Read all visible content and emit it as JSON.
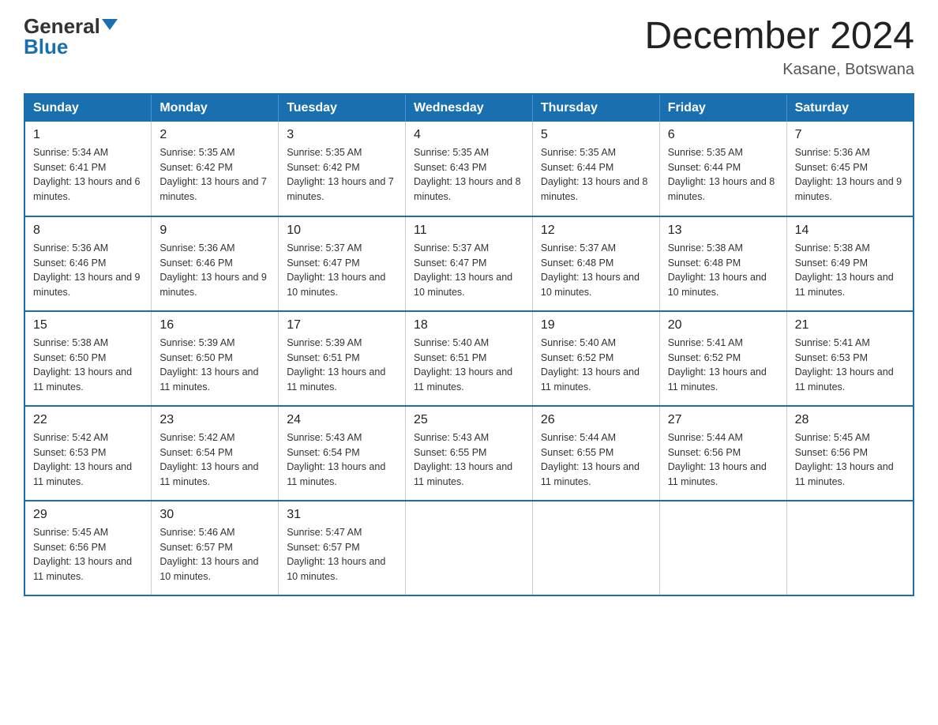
{
  "header": {
    "logo_general": "General",
    "logo_blue": "Blue",
    "month_title": "December 2024",
    "location": "Kasane, Botswana"
  },
  "days_of_week": [
    "Sunday",
    "Monday",
    "Tuesday",
    "Wednesday",
    "Thursday",
    "Friday",
    "Saturday"
  ],
  "weeks": [
    [
      {
        "day": "1",
        "sunrise": "5:34 AM",
        "sunset": "6:41 PM",
        "daylight": "13 hours and 6 minutes."
      },
      {
        "day": "2",
        "sunrise": "5:35 AM",
        "sunset": "6:42 PM",
        "daylight": "13 hours and 7 minutes."
      },
      {
        "day": "3",
        "sunrise": "5:35 AM",
        "sunset": "6:42 PM",
        "daylight": "13 hours and 7 minutes."
      },
      {
        "day": "4",
        "sunrise": "5:35 AM",
        "sunset": "6:43 PM",
        "daylight": "13 hours and 8 minutes."
      },
      {
        "day": "5",
        "sunrise": "5:35 AM",
        "sunset": "6:44 PM",
        "daylight": "13 hours and 8 minutes."
      },
      {
        "day": "6",
        "sunrise": "5:35 AM",
        "sunset": "6:44 PM",
        "daylight": "13 hours and 8 minutes."
      },
      {
        "day": "7",
        "sunrise": "5:36 AM",
        "sunset": "6:45 PM",
        "daylight": "13 hours and 9 minutes."
      }
    ],
    [
      {
        "day": "8",
        "sunrise": "5:36 AM",
        "sunset": "6:46 PM",
        "daylight": "13 hours and 9 minutes."
      },
      {
        "day": "9",
        "sunrise": "5:36 AM",
        "sunset": "6:46 PM",
        "daylight": "13 hours and 9 minutes."
      },
      {
        "day": "10",
        "sunrise": "5:37 AM",
        "sunset": "6:47 PM",
        "daylight": "13 hours and 10 minutes."
      },
      {
        "day": "11",
        "sunrise": "5:37 AM",
        "sunset": "6:47 PM",
        "daylight": "13 hours and 10 minutes."
      },
      {
        "day": "12",
        "sunrise": "5:37 AM",
        "sunset": "6:48 PM",
        "daylight": "13 hours and 10 minutes."
      },
      {
        "day": "13",
        "sunrise": "5:38 AM",
        "sunset": "6:48 PM",
        "daylight": "13 hours and 10 minutes."
      },
      {
        "day": "14",
        "sunrise": "5:38 AM",
        "sunset": "6:49 PM",
        "daylight": "13 hours and 11 minutes."
      }
    ],
    [
      {
        "day": "15",
        "sunrise": "5:38 AM",
        "sunset": "6:50 PM",
        "daylight": "13 hours and 11 minutes."
      },
      {
        "day": "16",
        "sunrise": "5:39 AM",
        "sunset": "6:50 PM",
        "daylight": "13 hours and 11 minutes."
      },
      {
        "day": "17",
        "sunrise": "5:39 AM",
        "sunset": "6:51 PM",
        "daylight": "13 hours and 11 minutes."
      },
      {
        "day": "18",
        "sunrise": "5:40 AM",
        "sunset": "6:51 PM",
        "daylight": "13 hours and 11 minutes."
      },
      {
        "day": "19",
        "sunrise": "5:40 AM",
        "sunset": "6:52 PM",
        "daylight": "13 hours and 11 minutes."
      },
      {
        "day": "20",
        "sunrise": "5:41 AM",
        "sunset": "6:52 PM",
        "daylight": "13 hours and 11 minutes."
      },
      {
        "day": "21",
        "sunrise": "5:41 AM",
        "sunset": "6:53 PM",
        "daylight": "13 hours and 11 minutes."
      }
    ],
    [
      {
        "day": "22",
        "sunrise": "5:42 AM",
        "sunset": "6:53 PM",
        "daylight": "13 hours and 11 minutes."
      },
      {
        "day": "23",
        "sunrise": "5:42 AM",
        "sunset": "6:54 PM",
        "daylight": "13 hours and 11 minutes."
      },
      {
        "day": "24",
        "sunrise": "5:43 AM",
        "sunset": "6:54 PM",
        "daylight": "13 hours and 11 minutes."
      },
      {
        "day": "25",
        "sunrise": "5:43 AM",
        "sunset": "6:55 PM",
        "daylight": "13 hours and 11 minutes."
      },
      {
        "day": "26",
        "sunrise": "5:44 AM",
        "sunset": "6:55 PM",
        "daylight": "13 hours and 11 minutes."
      },
      {
        "day": "27",
        "sunrise": "5:44 AM",
        "sunset": "6:56 PM",
        "daylight": "13 hours and 11 minutes."
      },
      {
        "day": "28",
        "sunrise": "5:45 AM",
        "sunset": "6:56 PM",
        "daylight": "13 hours and 11 minutes."
      }
    ],
    [
      {
        "day": "29",
        "sunrise": "5:45 AM",
        "sunset": "6:56 PM",
        "daylight": "13 hours and 11 minutes."
      },
      {
        "day": "30",
        "sunrise": "5:46 AM",
        "sunset": "6:57 PM",
        "daylight": "13 hours and 10 minutes."
      },
      {
        "day": "31",
        "sunrise": "5:47 AM",
        "sunset": "6:57 PM",
        "daylight": "13 hours and 10 minutes."
      },
      null,
      null,
      null,
      null
    ]
  ]
}
